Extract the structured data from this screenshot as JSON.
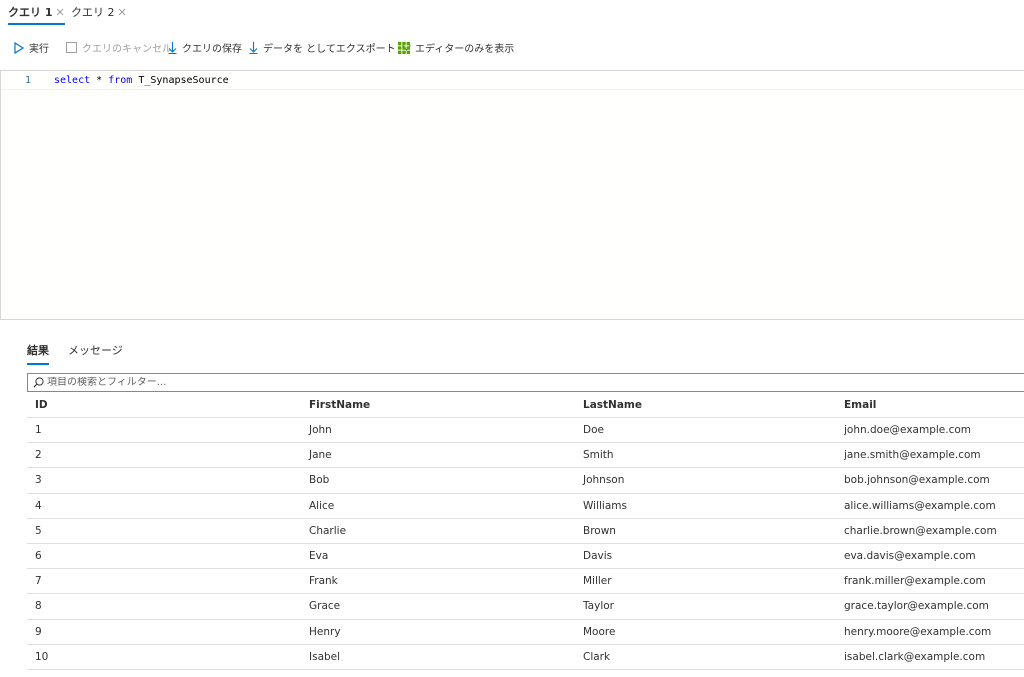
{
  "tabs": [
    {
      "label": "クエリ 1",
      "close": "✕",
      "active": true
    },
    {
      "label": "クエリ 2",
      "close": "✕",
      "active": false
    }
  ],
  "toolbar": {
    "run": "実行",
    "cancel": "クエリのキャンセル",
    "save": "クエリの保存",
    "export": "データを としてエクスポート",
    "editor_only": "エディターのみを表示"
  },
  "editor": {
    "line_number": "1",
    "keyword_select": "select",
    "star": "*",
    "keyword_from": "from",
    "table": "T_SynapseSource"
  },
  "results": {
    "tabs": [
      "結果",
      "メッセージ"
    ],
    "filter_placeholder": "項目の検索とフィルター...",
    "columns": [
      "ID",
      "FirstName",
      "LastName",
      "Email"
    ],
    "rows": [
      [
        "1",
        "John",
        "Doe",
        "john.doe@example.com"
      ],
      [
        "2",
        "Jane",
        "Smith",
        "jane.smith@example.com"
      ],
      [
        "3",
        "Bob",
        "Johnson",
        "bob.johnson@example.com"
      ],
      [
        "4",
        "Alice",
        "Williams",
        "alice.williams@example.com"
      ],
      [
        "5",
        "Charlie",
        "Brown",
        "charlie.brown@example.com"
      ],
      [
        "6",
        "Eva",
        "Davis",
        "eva.davis@example.com"
      ],
      [
        "7",
        "Frank",
        "Miller",
        "frank.miller@example.com"
      ],
      [
        "8",
        "Grace",
        "Taylor",
        "grace.taylor@example.com"
      ],
      [
        "9",
        "Henry",
        "Moore",
        "henry.moore@example.com"
      ],
      [
        "10",
        "Isabel",
        "Clark",
        "isabel.clark@example.com"
      ]
    ]
  },
  "colors": {
    "accent": "#0078d4",
    "grid_icon": "#57a300"
  }
}
